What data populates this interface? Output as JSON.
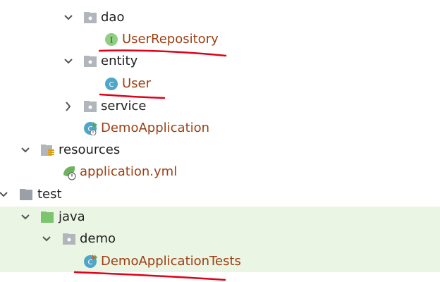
{
  "tree": {
    "nodes": [
      {
        "label": "dao",
        "kind": "package",
        "state": "expanded"
      },
      {
        "label": "UserRepository",
        "kind": "interface",
        "icon_letter": "I"
      },
      {
        "label": "entity",
        "kind": "package",
        "state": "expanded"
      },
      {
        "label": "User",
        "kind": "class",
        "icon_letter": "C"
      },
      {
        "label": "service",
        "kind": "package",
        "state": "collapsed"
      },
      {
        "label": "DemoApplication",
        "kind": "spring-boot-app",
        "icon_letter": "C"
      },
      {
        "label": "resources",
        "kind": "resources-folder",
        "state": "expanded"
      },
      {
        "label": "application.yml",
        "kind": "spring-config-file"
      },
      {
        "label": "test",
        "kind": "folder",
        "state": "expanded"
      },
      {
        "label": "java",
        "kind": "test-sources-root",
        "state": "expanded"
      },
      {
        "label": "demo",
        "kind": "package",
        "state": "expanded"
      },
      {
        "label": "DemoApplicationTests",
        "kind": "test-class",
        "icon_letter": "C"
      }
    ]
  },
  "colors": {
    "file_label": "#9c3e12",
    "folder_label": "#1f1f1f",
    "test_highlight": "#eaf5e4",
    "annotation_underline": "#e0001a",
    "interface_icon": "#8fce83",
    "class_icon": "#4ea6c9",
    "test_folder": "#7cc46d",
    "folder": "#9aa0a6"
  },
  "annotations": {
    "underlines": [
      "UserRepository",
      "User",
      "DemoApplicationTests"
    ]
  }
}
